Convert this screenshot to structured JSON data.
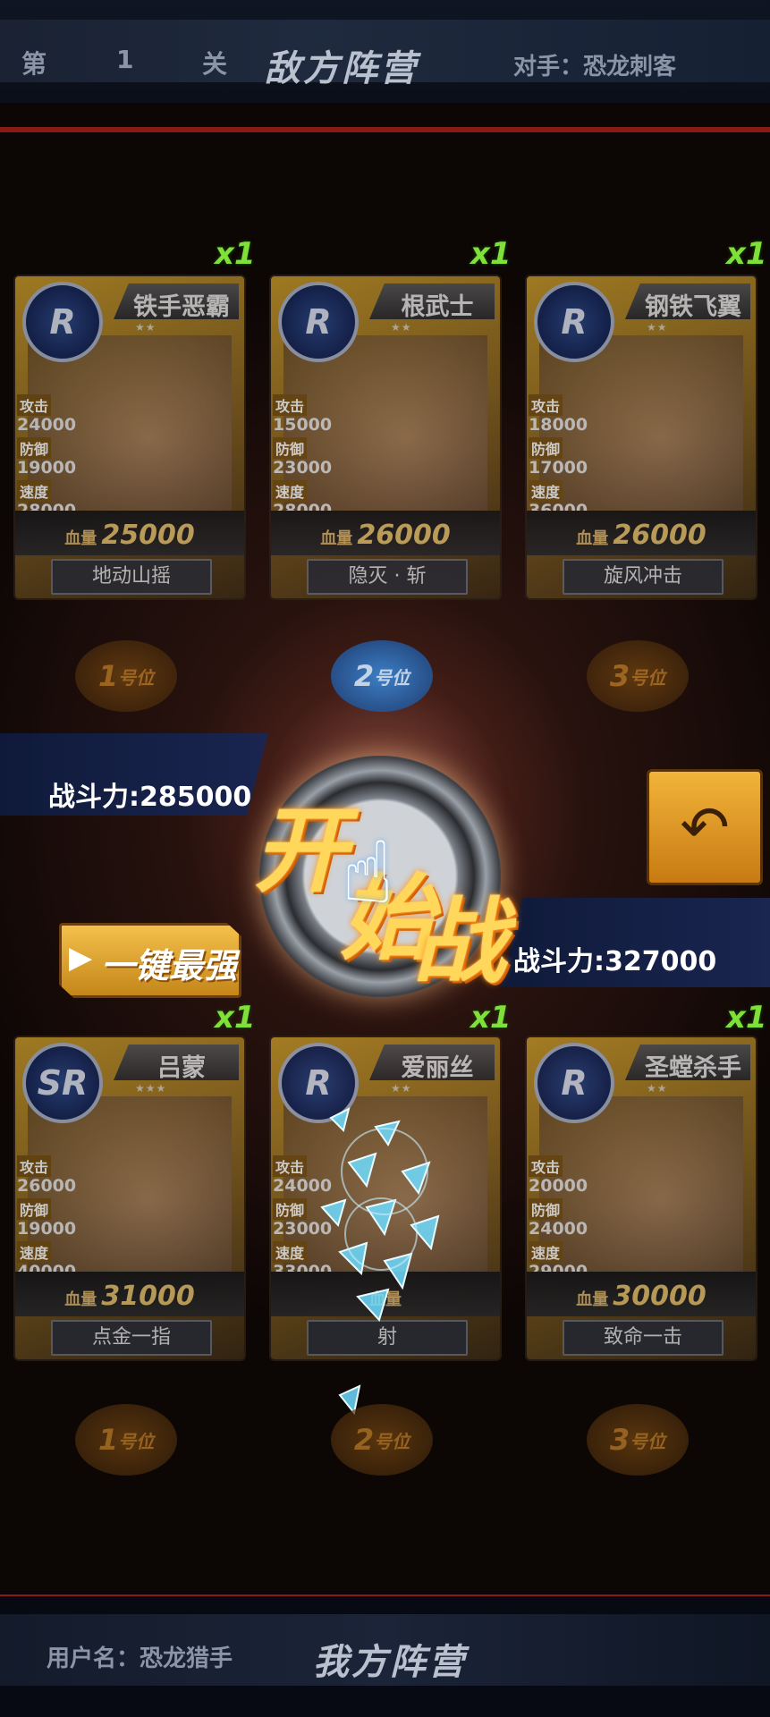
{
  "header": {
    "stage_prefix": "第",
    "stage_number": "1",
    "stage_suffix": "关",
    "enemy_title": "敌方阵营",
    "opponent": "对手：恐龙刺客"
  },
  "enemy_cards": [
    {
      "name": "铁手恶霸",
      "rank": "R",
      "stars": "★★",
      "multiplier": "x1",
      "atk_label": "攻击",
      "atk": "24000",
      "def_label": "防御",
      "def": "19000",
      "spd_label": "速度",
      "spd": "28000",
      "hp_label": "血量",
      "hp": "25000",
      "skill": "地动山摇"
    },
    {
      "name": "根武士",
      "rank": "R",
      "stars": "★★",
      "multiplier": "x1",
      "atk_label": "攻击",
      "atk": "15000",
      "def_label": "防御",
      "def": "23000",
      "spd_label": "速度",
      "spd": "28000",
      "hp_label": "血量",
      "hp": "26000",
      "skill": "隐灭 · 斩"
    },
    {
      "name": "钢铁飞翼",
      "rank": "R",
      "stars": "★★",
      "multiplier": "x1",
      "atk_label": "攻击",
      "atk": "18000",
      "def_label": "防御",
      "def": "17000",
      "spd_label": "速度",
      "spd": "36000",
      "hp_label": "血量",
      "hp": "26000",
      "skill": "旋风冲击"
    }
  ],
  "player_cards": [
    {
      "name": "吕蒙",
      "rank": "SR",
      "stars": "★★★",
      "multiplier": "x1",
      "atk_label": "攻击",
      "atk": "26000",
      "def_label": "防御",
      "def": "19000",
      "spd_label": "速度",
      "spd": "40000",
      "hp_label": "血量",
      "hp": "31000",
      "skill": "点金一指"
    },
    {
      "name": "爱丽丝",
      "rank": "R",
      "stars": "★★",
      "multiplier": "x1",
      "atk_label": "攻击",
      "atk": "24000",
      "def_label": "防御",
      "def": "23000",
      "spd_label": "速度",
      "spd": "33000",
      "hp_label": "血量",
      "hp": "",
      "skill": "射"
    },
    {
      "name": "圣螳杀手",
      "rank": "R",
      "stars": "★★",
      "multiplier": "x1",
      "atk_label": "攻击",
      "atk": "20000",
      "def_label": "防御",
      "def": "24000",
      "spd_label": "速度",
      "spd": "29000",
      "hp_label": "血量",
      "hp": "30000",
      "skill": "致命一击"
    }
  ],
  "slots": {
    "enemy": [
      {
        "num": "1",
        "label": "号位"
      },
      {
        "num": "2",
        "label": "号位"
      },
      {
        "num": "3",
        "label": "号位"
      }
    ],
    "player": [
      {
        "num": "1",
        "label": "号位"
      },
      {
        "num": "2",
        "label": "号位"
      },
      {
        "num": "3",
        "label": "号位"
      }
    ]
  },
  "enemy_power": "战斗力:285000",
  "player_power": "战斗力:327000",
  "start_button": {
    "line1": "开",
    "line2": "始",
    "line3": "战"
  },
  "auto_button": "一键最强",
  "undo_icon": "undo-arrow-icon",
  "footer": {
    "username": "用户名：恐龙猎手",
    "team_title": "我方阵营"
  },
  "colors": {
    "accent_gold": "#f2b43a",
    "multiplier_green": "#7fe03a",
    "slot_blue": "#3c8ad8"
  }
}
